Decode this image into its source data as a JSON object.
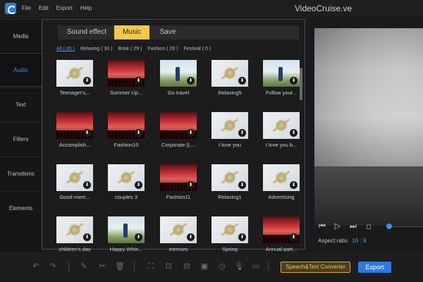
{
  "app": {
    "title": "VideoCruise.ve"
  },
  "menu": [
    "File",
    "Edit",
    "Export",
    "Help"
  ],
  "sidebar": {
    "items": [
      {
        "label": "Media"
      },
      {
        "label": "Audio",
        "active": true
      },
      {
        "label": "Text"
      },
      {
        "label": "Filters"
      },
      {
        "label": "Transitions"
      },
      {
        "label": "Elements"
      }
    ]
  },
  "tabs": [
    {
      "label": "Sound effect"
    },
    {
      "label": "Music",
      "active": true
    },
    {
      "label": "Save"
    }
  ],
  "filters": [
    {
      "label": "All ( 85 )",
      "active": true
    },
    {
      "label": "Relaxing ( 30 )"
    },
    {
      "label": "Brisk ( 29 )"
    },
    {
      "label": "Fashion ( 26 )"
    },
    {
      "label": "Festival ( 0 )"
    }
  ],
  "tracks": [
    {
      "label": "Teenager's...",
      "thumb": "leaf"
    },
    {
      "label": "Summer Up...",
      "thumb": "concert"
    },
    {
      "label": "Go travel",
      "thumb": "travel"
    },
    {
      "label": "Relaxing5",
      "thumb": "leaf"
    },
    {
      "label": "Follow your...",
      "thumb": "travel"
    },
    {
      "label": "Accomplish...",
      "thumb": "concert"
    },
    {
      "label": "Fashion10",
      "thumb": "concert"
    },
    {
      "label": "Corporate (L...",
      "thumb": "concert"
    },
    {
      "label": "I love you",
      "thumb": "leaf"
    },
    {
      "label": "I love you b...",
      "thumb": "leaf"
    },
    {
      "label": "Good mem...",
      "thumb": "leaf"
    },
    {
      "label": "couples 3",
      "thumb": "leaf"
    },
    {
      "label": "Fashion11",
      "thumb": "concert"
    },
    {
      "label": "Relaxing1",
      "thumb": "leaf"
    },
    {
      "label": "Advertising",
      "thumb": "leaf"
    },
    {
      "label": "children's day",
      "thumb": "leaf"
    },
    {
      "label": "Happy Whis...",
      "thumb": "travel"
    },
    {
      "label": "memory",
      "thumb": "leaf"
    },
    {
      "label": "Spring",
      "thumb": "leaf"
    },
    {
      "label": "Annual part...",
      "thumb": "concert"
    }
  ],
  "preview": {
    "aspect_label": "Aspect ratio",
    "aspect_value": "16 : 9",
    "progress": 0.0
  },
  "bottom": {
    "convert_label": "Speech&Text Converter",
    "export_label": "Export"
  },
  "colors": {
    "accent": "#2c7ae0",
    "music_tab": "#f2c94c",
    "convert": "#d4a83a"
  }
}
